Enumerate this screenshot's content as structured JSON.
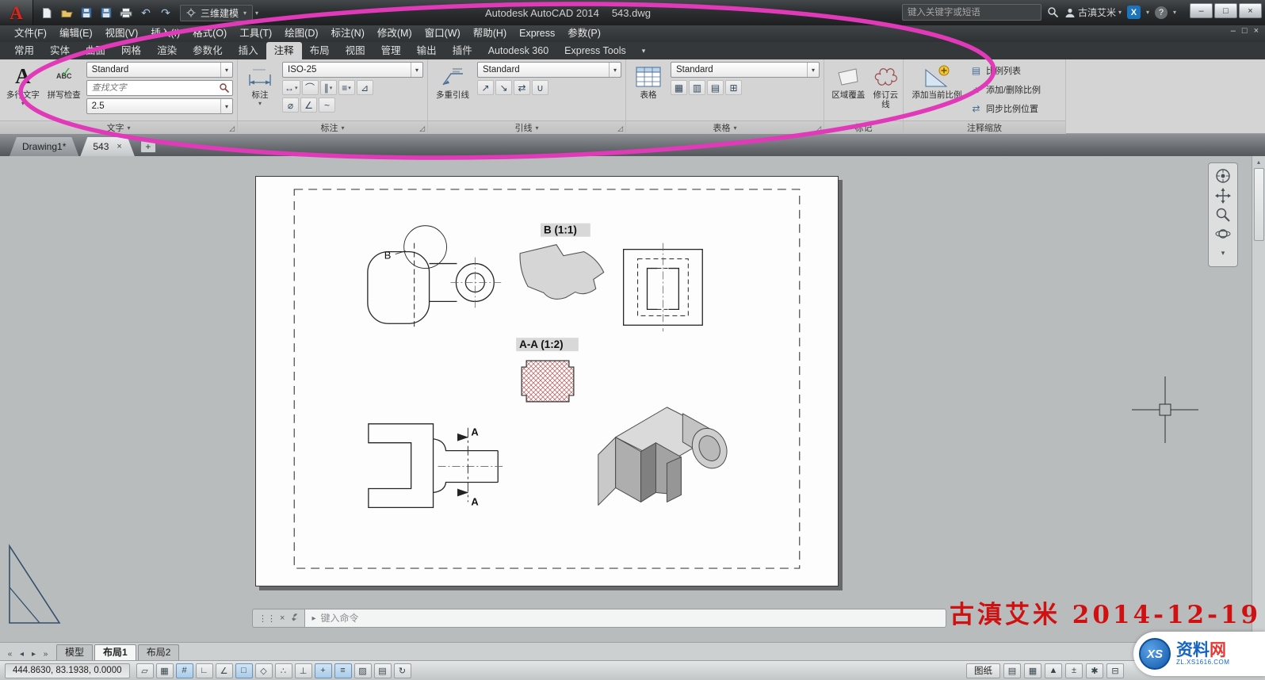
{
  "glyphs": {
    "dropdown": "▾",
    "launcher": "◿",
    "close": "×",
    "check": "✓",
    "grip": "⋮⋮",
    "prompt": "▸",
    "plus": "+",
    "nav_first": "«",
    "nav_prev": "◂",
    "nav_next": "▸",
    "nav_last": "»",
    "up": "▴",
    "down": "▾",
    "undo": "↶",
    "redo": "↷",
    "minimize": "–",
    "restore": "□",
    "win_close": "×"
  },
  "title_bar": {
    "logo_letter": "A",
    "qat_icons": [
      "qat-new",
      "qat-open",
      "qat-save",
      "qat-saveas",
      "qat-plot",
      "qat-undo",
      "qat-redo"
    ],
    "workspace_value": "三维建模",
    "app_title": "Autodesk AutoCAD 2014",
    "doc_title": "543.dwg",
    "search_placeholder": "键入关键字或短语",
    "user_name": "古滇艾米",
    "exchange_label": "X",
    "help_label": "?"
  },
  "menu_bar": {
    "items": [
      "文件(F)",
      "编辑(E)",
      "视图(V)",
      "插入(I)",
      "格式(O)",
      "工具(T)",
      "绘图(D)",
      "标注(N)",
      "修改(M)",
      "窗口(W)",
      "帮助(H)",
      "Express",
      "参数(P)"
    ]
  },
  "ribbon": {
    "tabs": [
      "常用",
      "实体",
      "曲面",
      "网格",
      "渲染",
      "参数化",
      "插入",
      "注释",
      "布局",
      "视图",
      "管理",
      "输出",
      "插件",
      "Autodesk 360",
      "Express Tools"
    ],
    "active_tab": "注释",
    "text_panel": {
      "footer": "文字",
      "mtext_icon": "A",
      "mtext_label": "多行文字",
      "spell_icon": "ABC",
      "spell_label": "拼写检查",
      "style_value": "Standard",
      "find_placeholder": "查找文字",
      "height_value": "2.5"
    },
    "dim_panel": {
      "footer": "标注",
      "button_label": "标注",
      "style_value": "ISO-25",
      "tools": [
        {
          "name": "linear-dimension",
          "glyph": "↔"
        },
        {
          "name": "quick-dimension",
          "glyph": "⌒"
        },
        {
          "name": "continue-dimension",
          "glyph": "∥"
        },
        {
          "name": "dimension-break",
          "glyph": "≡"
        },
        {
          "name": "adjust-space",
          "glyph": "⊿"
        }
      ],
      "tools2": [
        {
          "name": "diameter-dimension",
          "glyph": "⌀"
        },
        {
          "name": "angular-dimension",
          "glyph": "∠"
        },
        {
          "name": "jogged-dimension",
          "glyph": "~"
        }
      ]
    },
    "leader_panel": {
      "footer": "引线",
      "button_label": "多重引线",
      "style_value": "Standard",
      "tools": [
        {
          "name": "add-leader",
          "glyph": "↗"
        },
        {
          "name": "remove-leader",
          "glyph": "↘"
        },
        {
          "name": "align-leaders",
          "glyph": "⇄"
        },
        {
          "name": "collect-leaders",
          "glyph": "∪"
        }
      ]
    },
    "table_panel": {
      "footer": "表格",
      "button_label": "表格",
      "style_value": "Standard",
      "tools": [
        {
          "name": "table-cell-style-top",
          "glyph": "▦"
        },
        {
          "name": "table-cell-style-middle",
          "glyph": "▥"
        },
        {
          "name": "table-cell-style-bottom",
          "glyph": "▤"
        },
        {
          "name": "insert-table",
          "glyph": "⊞"
        }
      ]
    },
    "markup_panel": {
      "footer": "标记",
      "wipeout_label": "区域覆盖",
      "revcloud_label": "修订云线"
    },
    "scale_panel": {
      "footer": "注释缩放",
      "add_current_label": "添加当前比例",
      "scale_list_label": "比例列表",
      "add_delete_label": "添加/删除比例",
      "sync_label": "同步比例位置"
    }
  },
  "file_tabs": {
    "tabs": [
      "Drawing1*",
      "543"
    ],
    "active": "543"
  },
  "drawing": {
    "detail_label": "B (1:1)",
    "section_label": "A-A (1:2)",
    "detail_ref": "B",
    "section_ref_top": "A",
    "section_ref_bottom": "A"
  },
  "command_line": {
    "prompt_placeholder": "键入命令"
  },
  "watermark": {
    "text": "古滇艾米 2014-12-19"
  },
  "layout_bar": {
    "tabs": [
      "模型",
      "布局1",
      "布局2"
    ],
    "active": "布局1"
  },
  "status_bar": {
    "coordinates": "444.8630, 83.1938, 0.0000",
    "paper_label": "图纸",
    "toggles": [
      {
        "name": "infer-constraints",
        "glyph": "▱",
        "on": false
      },
      {
        "name": "snap-mode",
        "glyph": "▦",
        "on": false
      },
      {
        "name": "grid-display",
        "glyph": "#",
        "on": true
      },
      {
        "name": "ortho-mode",
        "glyph": "∟",
        "on": false
      },
      {
        "name": "polar-tracking",
        "glyph": "∠",
        "on": false
      },
      {
        "name": "object-snap",
        "glyph": "□",
        "on": true
      },
      {
        "name": "3d-object-snap",
        "glyph": "◇",
        "on": false
      },
      {
        "name": "object-snap-tracking",
        "glyph": "∴",
        "on": false
      },
      {
        "name": "dynamic-ucs",
        "glyph": "⊥",
        "on": false
      },
      {
        "name": "dynamic-input",
        "glyph": "+",
        "on": true
      },
      {
        "name": "lineweight",
        "glyph": "≡",
        "on": true
      },
      {
        "name": "transparency",
        "glyph": "▨",
        "on": false
      },
      {
        "name": "quick-properties",
        "glyph": "▤",
        "on": false
      },
      {
        "name": "selection-cycling",
        "glyph": "↻",
        "on": false
      }
    ],
    "right_icons": [
      {
        "name": "quick-view-layouts",
        "glyph": "▤"
      },
      {
        "name": "quick-view-drawings",
        "glyph": "▦"
      },
      {
        "name": "annotation-scale",
        "glyph": "▲"
      },
      {
        "name": "auto-add-scales",
        "glyph": "±"
      },
      {
        "name": "workspace-switching",
        "glyph": "✱"
      },
      {
        "name": "toolbar-lock",
        "glyph": "⊟"
      }
    ]
  },
  "navbar": {
    "icons": [
      "navigation-wheel",
      "pan",
      "zoom",
      "orbit",
      "navbar-menu"
    ]
  },
  "site_logo": {
    "badge": "XS",
    "name_blue": "资料",
    "name_red": "网",
    "url": "ZL.XS1616.COM"
  }
}
